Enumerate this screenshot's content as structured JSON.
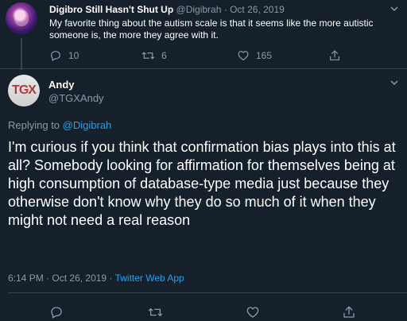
{
  "parent_tweet": {
    "display_name": "Digibro Still Hasn't Shut Up",
    "handle": "@Digibrah",
    "separator": "·",
    "date": "Oct 26, 2019",
    "text": "My favorite thing about the autism scale is that it seems like the more autistic someone is, the more they agree with it.",
    "reply_count": "10",
    "retweet_count": "6",
    "like_count": "165",
    "avatar_icon": "avatar-image"
  },
  "reply_tweet": {
    "display_name": "Andy",
    "handle": "@TGXAndy",
    "avatar_text": "TGX",
    "replying_to_label": "Replying to",
    "replying_to_handle": "@Digibrah",
    "text": "I'm curious if you think that confirmation bias plays into this at all? Somebody looking for affirmation for themselves being at high consumption of database-type media just because they otherwise don't know why they do so much of it when they might not need a real reason",
    "time": "6:14 PM",
    "date": "Oct 26, 2019",
    "separator": "·",
    "source": "Twitter Web App"
  },
  "colors": {
    "background": "#15202b",
    "text": "#ffffff",
    "muted": "#8899a6",
    "accent": "#1da1f2",
    "divider": "#38444d"
  },
  "icons": [
    "reply-icon",
    "retweet-icon",
    "like-icon",
    "share-icon",
    "chevron-down-icon"
  ]
}
